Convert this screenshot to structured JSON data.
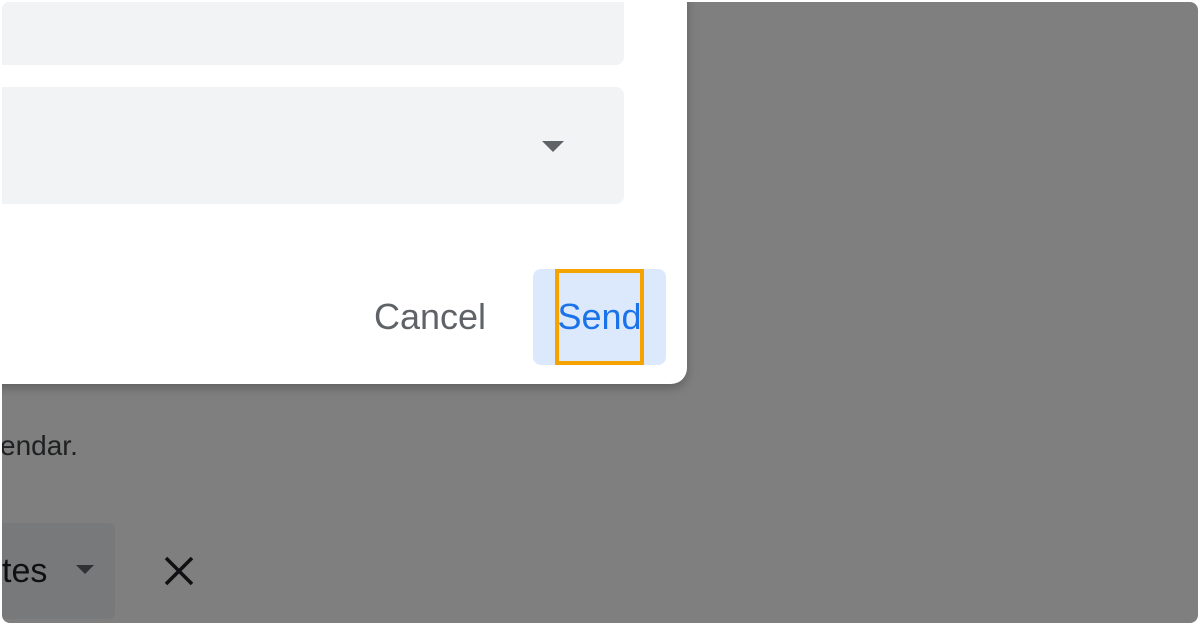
{
  "background_page": {
    "helper_text": "endar.",
    "select_label": "tes"
  },
  "dialog": {
    "cancel_label": "Cancel",
    "send_label": "Send"
  },
  "colors": {
    "scrim": "#000000",
    "primary": "#1a73e8",
    "send_highlight_bg": "#dce8fb",
    "focus_outline": "#f5a300",
    "field_bg": "#f1f3f4"
  },
  "icons": [
    "chevron-down-icon",
    "close-icon"
  ]
}
